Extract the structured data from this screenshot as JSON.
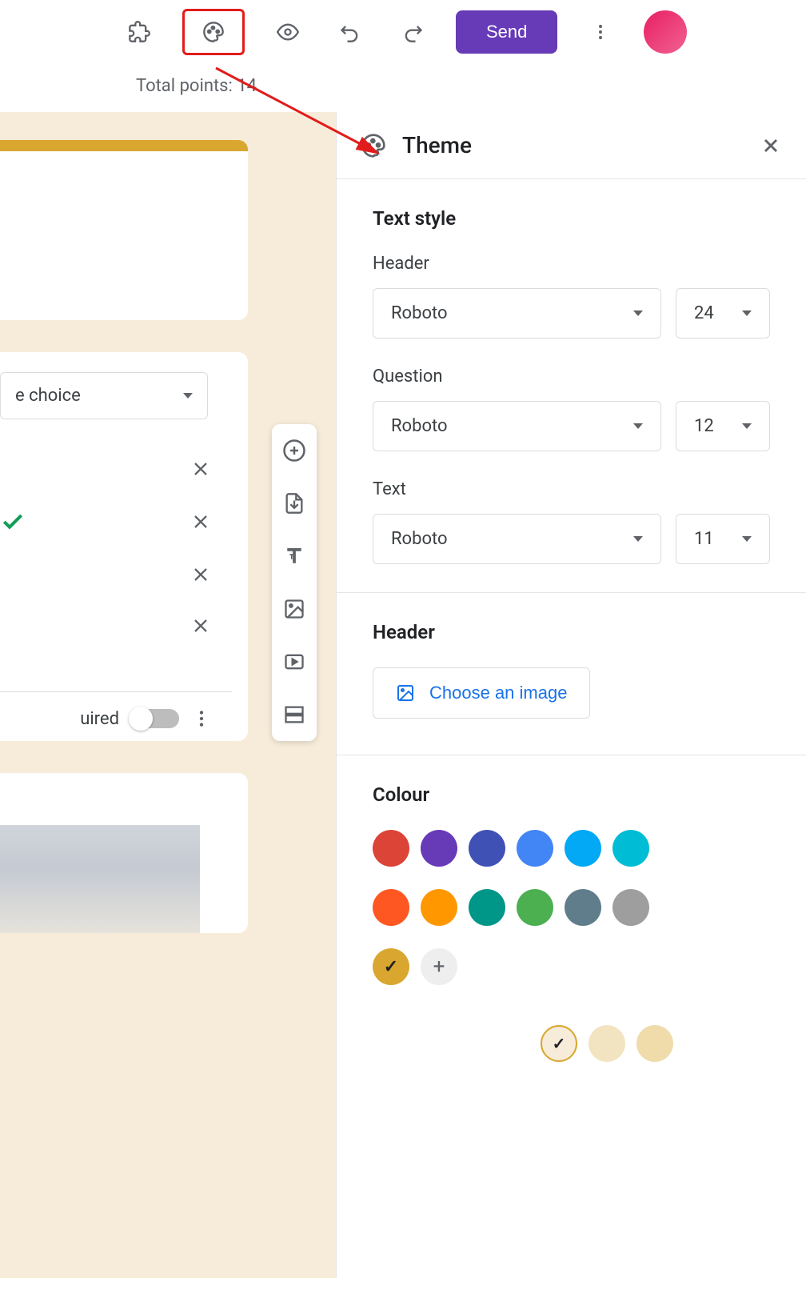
{
  "toolbar": {
    "send_label": "Send"
  },
  "points_bar": "Total points: 14",
  "question_type": "e choice",
  "required_label": "uired",
  "theme": {
    "title": "Theme",
    "text_style_title": "Text style",
    "header_label": "Header",
    "header_font": "Roboto",
    "header_size": "24",
    "question_label": "Question",
    "question_font": "Roboto",
    "question_size": "12",
    "text_label": "Text",
    "text_font": "Roboto",
    "text_size": "11",
    "header_section_title": "Header",
    "choose_image_label": "Choose an image",
    "colour_title": "Colour",
    "colours": [
      "#db4437",
      "#673ab7",
      "#3f51b5",
      "#4285f4",
      "#03a9f4",
      "#00bcd4",
      "#ff5722",
      "#ff9800",
      "#009688",
      "#4caf50",
      "#607d8b",
      "#9e9e9e",
      "#d9a72f"
    ],
    "selected_colour_index": 12,
    "background_colours": [
      "#f7ecd9",
      "#f3e4c1",
      "#efdcaa"
    ],
    "selected_bg_index": 0
  }
}
